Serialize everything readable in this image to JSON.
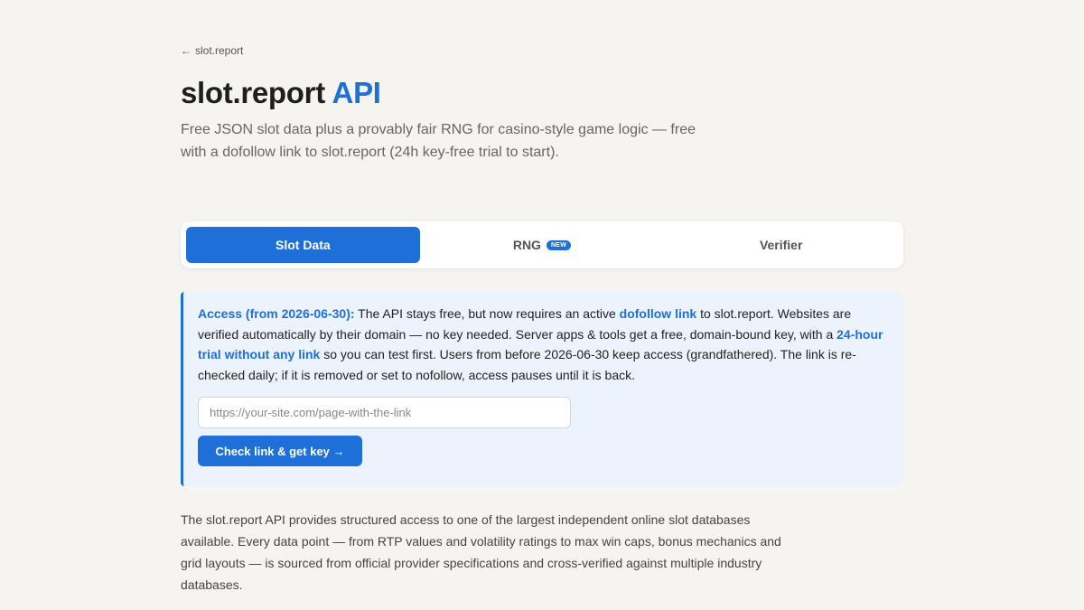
{
  "header": {
    "back_arrow": "←",
    "back_label": "slot.report",
    "title_main": "slot.report ",
    "title_accent": "API",
    "subtitle": "Free JSON slot data plus a provably fair RNG for casino-style game logic — free with a dofollow link to slot.report (24h key-free trial to start)."
  },
  "tabs": [
    {
      "label": "Slot Data",
      "active": true
    },
    {
      "label": "RNG",
      "badge": "NEW",
      "active": false
    },
    {
      "label": "Verifier",
      "active": false
    }
  ],
  "notice": {
    "lead": "Access (from 2026-06-30):",
    "t1": " The API stays free, but now requires an active ",
    "link1": "dofollow link",
    "t2": " to slot.report. Websites are verified automatically by their domain — no key needed. Server apps & tools get a free, domain-bound key, with a ",
    "link2": "24-hour trial without any link",
    "t3": " so you can test first. Users from before 2026-06-30 keep access (grandfathered). The link is re-checked daily; if it is removed or set to nofollow, access pauses until it is back.",
    "input_placeholder": "https://your-site.com/page-with-the-link",
    "input_value": "",
    "button_label": "Check link & get key →"
  },
  "intro": "The slot.report API provides structured access to one of the largest independent online slot databases available. Every data point — from RTP values and volatility ratings to max win caps, bonus mechanics and grid layouts — is sourced from official provider specifications and cross-verified against multiple industry databases.",
  "colors": {
    "accent": "#1f6fd9",
    "background": "#f5f4f1",
    "notice_bg": "#edf3fc"
  }
}
